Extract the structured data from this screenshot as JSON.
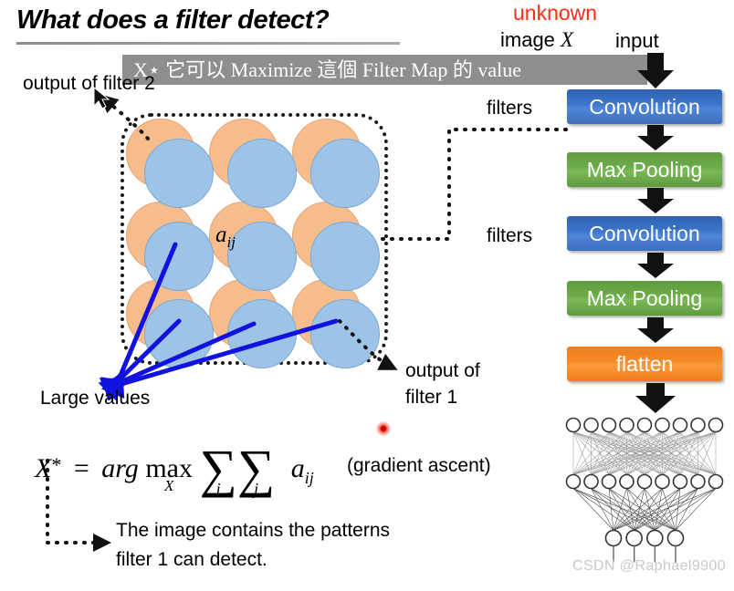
{
  "slide": {
    "title": "What does a filter detect?",
    "subtitle_overlay": "X⋆ 它可以 Maximize 這個 Filter Map 的 value"
  },
  "labels": {
    "output_of_filter_2": "output of filter 2",
    "unknown": "unknown",
    "image_x_prefix": "image ",
    "image_x_var": "X",
    "input": "input",
    "filters_1": "filters",
    "filters_2": "filters",
    "large_values": "Large values",
    "output_of_filter_1_line1": "output of",
    "output_of_filter_1_line2": "filter 1",
    "gradient_ascent": "(gradient ascent)",
    "conclusion_line1": "The image contains the patterns",
    "conclusion_line2": "filter 1 can detect.",
    "aij": "a",
    "aij_sub": "ij"
  },
  "formula": {
    "lhs": "X",
    "lhs_star": "*",
    "eq": "=",
    "arg": "arg",
    "max": "max",
    "max_sub": "X",
    "sigma": "∑",
    "sigma1_sub": "i",
    "sigma2_sub": "j",
    "term": "a",
    "term_sub": "ij"
  },
  "pipeline": {
    "blocks": [
      {
        "label": "Convolution",
        "kind": "conv",
        "color": "#3b74c9"
      },
      {
        "label": "Max Pooling",
        "kind": "pool",
        "color": "#6cab49"
      },
      {
        "label": "Convolution",
        "kind": "conv",
        "color": "#3b74c9"
      },
      {
        "label": "Max Pooling",
        "kind": "pool",
        "color": "#6cab49"
      },
      {
        "label": "flatten",
        "kind": "flat",
        "color": "#f68a28"
      }
    ]
  },
  "filter_map": {
    "rows": 3,
    "cols": 3,
    "orange_color": "#f6bc8c",
    "blue_color": "#9dc3e6",
    "highlighted_cell_label": "a_ij"
  },
  "neural_net": {
    "layer_node_counts": [
      9,
      9,
      4
    ]
  },
  "colors": {
    "accent_red": "#ff2d16",
    "subtitle_bar": "#8e8e8e",
    "arrow_blue": "#1212e0",
    "laser_red": "#ff0000",
    "watermark": "#c9c9c9"
  },
  "watermark": "CSDN @Raphael9900"
}
